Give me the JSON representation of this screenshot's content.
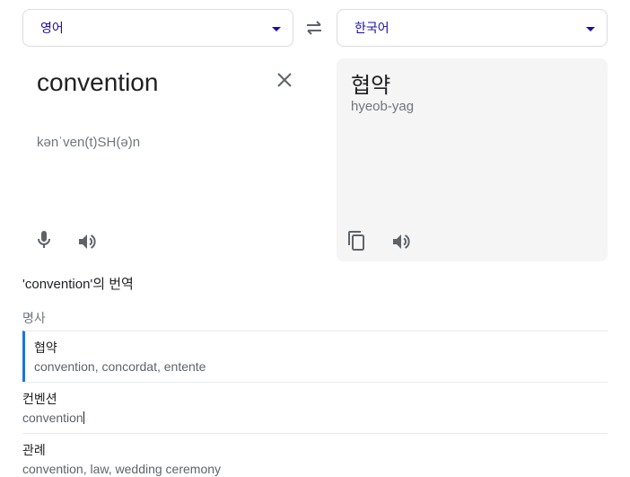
{
  "source_language": {
    "label": "영어"
  },
  "target_language": {
    "label": "한국어"
  },
  "icons": {
    "swap": "swap-languages-icon",
    "clear": "close-icon",
    "mic": "microphone-icon",
    "speaker": "speaker-icon",
    "copy": "copy-icon",
    "dropdown": "chevron-down-icon"
  },
  "source": {
    "text": "convention",
    "phonetic": "kənˈven(t)SH(ə)n"
  },
  "target": {
    "text": "협약",
    "romanization": "hyeob-yag"
  },
  "dictionary": {
    "heading": "'convention'의 번역",
    "part_of_speech": "명사",
    "entries": [
      {
        "word": "협약",
        "synonyms": "convention, concordat, entente"
      },
      {
        "word": "컨벤션",
        "synonyms": "convention"
      },
      {
        "word": "관례",
        "synonyms": "convention, law, wedding ceremony"
      }
    ]
  },
  "colors": {
    "accent": "#1a73e8",
    "link": "#1a0dab",
    "panel_bg": "#f5f5f5",
    "muted_text": "#70757a"
  }
}
